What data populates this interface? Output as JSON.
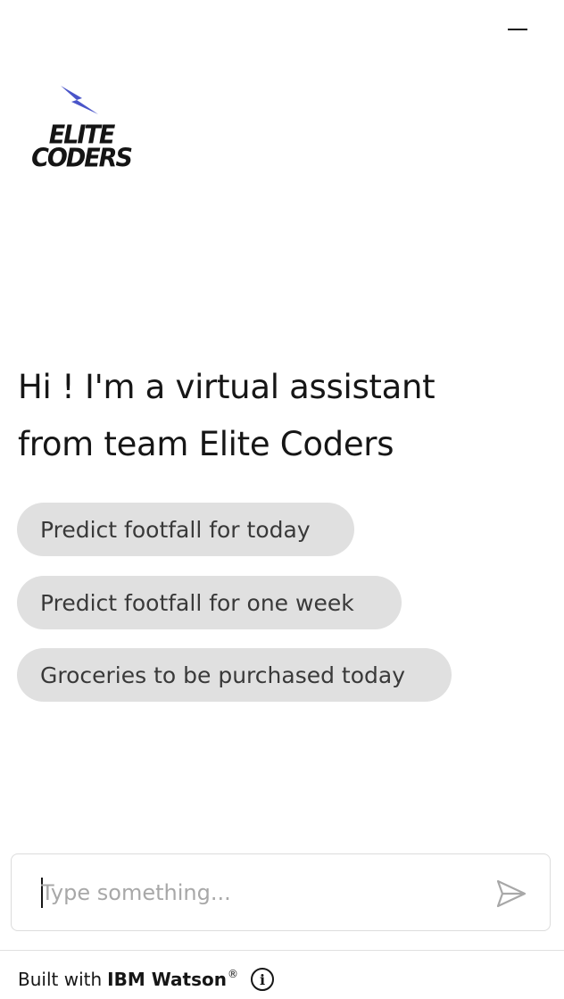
{
  "header": {
    "minimize_icon": "minimize-icon"
  },
  "logo": {
    "line1": "ELITE",
    "line2": "CODERS",
    "bolt_color": "#4a55c9",
    "icon": "lightning-bolt-icon"
  },
  "greeting": {
    "line1": "Hi ! I'm a virtual assistant",
    "line2": "from team Elite Coders"
  },
  "options": [
    {
      "label": "Predict footfall for today"
    },
    {
      "label": "Predict footfall for one week"
    },
    {
      "label": "Groceries to be purchased today"
    }
  ],
  "input": {
    "placeholder": "Type something...",
    "value": "",
    "send_icon": "send-icon"
  },
  "footer": {
    "built_with": "Built with",
    "brand": "IBM Watson",
    "registered": "®",
    "info_icon": "info-icon",
    "info_glyph": "i"
  },
  "colors": {
    "chip_background": "#e0e0e0",
    "chip_text": "#393939",
    "placeholder": "#a8a8a8"
  }
}
